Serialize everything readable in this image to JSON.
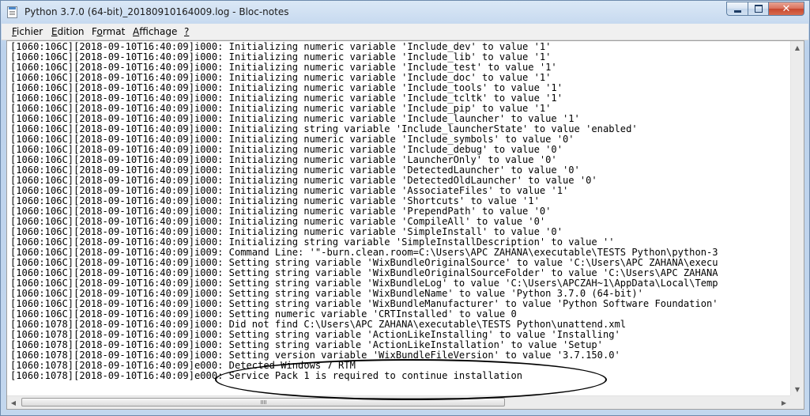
{
  "window": {
    "title": "Python 3.7.0 (64-bit)_20180910164009.log - Bloc-notes"
  },
  "menu": [
    {
      "label": "Fichier",
      "underline": "F",
      "rest": "ichier"
    },
    {
      "label": "Edition",
      "underline": "E",
      "rest": "dition"
    },
    {
      "label": "Format",
      "underline": "o",
      "pre": "F",
      "rest": "rmat"
    },
    {
      "label": "Affichage",
      "underline": "A",
      "rest": "ffichage"
    },
    {
      "label": "?",
      "underline": "?",
      "rest": ""
    }
  ],
  "log_lines": [
    "[1060:106C][2018-09-10T16:40:09]i000: Initializing numeric variable 'Include_dev' to value '1'",
    "[1060:106C][2018-09-10T16:40:09]i000: Initializing numeric variable 'Include_lib' to value '1'",
    "[1060:106C][2018-09-10T16:40:09]i000: Initializing numeric variable 'Include_test' to value '1'",
    "[1060:106C][2018-09-10T16:40:09]i000: Initializing numeric variable 'Include_doc' to value '1'",
    "[1060:106C][2018-09-10T16:40:09]i000: Initializing numeric variable 'Include_tools' to value '1'",
    "[1060:106C][2018-09-10T16:40:09]i000: Initializing numeric variable 'Include_tcltk' to value '1'",
    "[1060:106C][2018-09-10T16:40:09]i000: Initializing numeric variable 'Include_pip' to value '1'",
    "[1060:106C][2018-09-10T16:40:09]i000: Initializing numeric variable 'Include_launcher' to value '1'",
    "[1060:106C][2018-09-10T16:40:09]i000: Initializing string variable 'Include_launcherState' to value 'enabled'",
    "[1060:106C][2018-09-10T16:40:09]i000: Initializing numeric variable 'Include_symbols' to value '0'",
    "[1060:106C][2018-09-10T16:40:09]i000: Initializing numeric variable 'Include_debug' to value '0'",
    "[1060:106C][2018-09-10T16:40:09]i000: Initializing numeric variable 'LauncherOnly' to value '0'",
    "[1060:106C][2018-09-10T16:40:09]i000: Initializing numeric variable 'DetectedLauncher' to value '0'",
    "[1060:106C][2018-09-10T16:40:09]i000: Initializing numeric variable 'DetectedOldLauncher' to value '0'",
    "[1060:106C][2018-09-10T16:40:09]i000: Initializing numeric variable 'AssociateFiles' to value '1'",
    "[1060:106C][2018-09-10T16:40:09]i000: Initializing numeric variable 'Shortcuts' to value '1'",
    "[1060:106C][2018-09-10T16:40:09]i000: Initializing numeric variable 'PrependPath' to value '0'",
    "[1060:106C][2018-09-10T16:40:09]i000: Initializing numeric variable 'CompileAll' to value '0'",
    "[1060:106C][2018-09-10T16:40:09]i000: Initializing numeric variable 'SimpleInstall' to value '0'",
    "[1060:106C][2018-09-10T16:40:09]i000: Initializing string variable 'SimpleInstallDescription' to value ''",
    "[1060:106C][2018-09-10T16:40:09]i009: Command Line: '\"-burn.clean.room=C:\\Users\\APC ZAHANA\\executable\\TESTS Python\\python-3",
    "[1060:106C][2018-09-10T16:40:09]i000: Setting string variable 'WixBundleOriginalSource' to value 'C:\\Users\\APC ZAHANA\\execu",
    "[1060:106C][2018-09-10T16:40:09]i000: Setting string variable 'WixBundleOriginalSourceFolder' to value 'C:\\Users\\APC ZAHANA",
    "[1060:106C][2018-09-10T16:40:09]i000: Setting string variable 'WixBundleLog' to value 'C:\\Users\\APCZAH~1\\AppData\\Local\\Temp",
    "[1060:106C][2018-09-10T16:40:09]i000: Setting string variable 'WixBundleName' to value 'Python 3.7.0 (64-bit)'",
    "[1060:106C][2018-09-10T16:40:09]i000: Setting string variable 'WixBundleManufacturer' to value 'Python Software Foundation'",
    "[1060:106C][2018-09-10T16:40:09]i000: Setting numeric variable 'CRTInstalled' to value 0",
    "[1060:1078][2018-09-10T16:40:09]i000: Did not find C:\\Users\\APC ZAHANA\\executable\\TESTS Python\\unattend.xml",
    "[1060:1078][2018-09-10T16:40:09]i000: Setting string variable 'ActionLikeInstalling' to value 'Installing'",
    "[1060:1078][2018-09-10T16:40:09]i000: Setting string variable 'ActionLikeInstallation' to value 'Setup'",
    "[1060:1078][2018-09-10T16:40:09]i000: Setting version variable 'WixBundleFileVersion' to value '3.7.150.0'",
    "[1060:1078][2018-09-10T16:40:09]e000: Detected Windows 7 RTM",
    "[1060:1078][2018-09-10T16:40:09]e000: Service Pack 1 is required to continue installation"
  ],
  "icons": {
    "app": "notepad-icon",
    "minimize": "minimize-icon",
    "maximize": "maximize-icon",
    "close": "close-icon",
    "scroll_up": "arrow-up-icon",
    "scroll_down": "arrow-down-icon",
    "scroll_left": "arrow-left-icon",
    "scroll_right": "arrow-right-icon"
  },
  "glyphs": {
    "close": "✕",
    "up": "▲",
    "down": "▼",
    "left": "◀",
    "right": "▶"
  },
  "colors": {
    "titlebar": "#c6d9ef",
    "close_button": "#c7472e",
    "annotation": "#000000"
  }
}
